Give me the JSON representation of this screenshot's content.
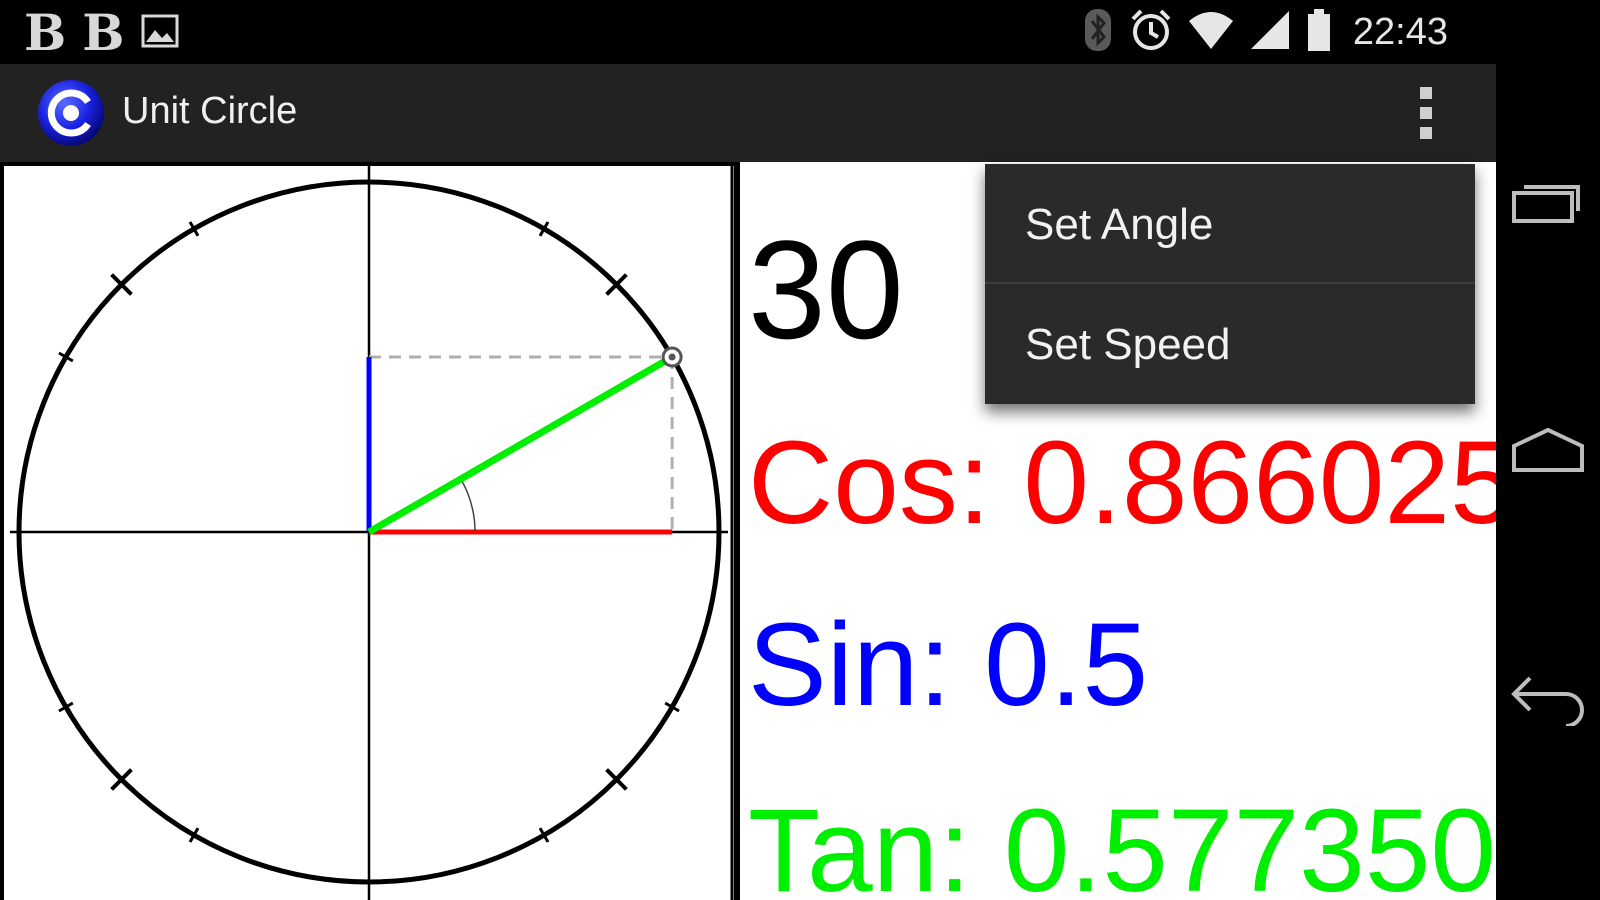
{
  "status_bar": {
    "left_icons": [
      {
        "name": "b-notification-icon",
        "glyph": "B"
      },
      {
        "name": "b-notification-icon",
        "glyph": "B"
      },
      {
        "name": "image-notification-icon"
      }
    ],
    "right_icons": [
      "bluetooth-icon",
      "alarm-clock-icon",
      "wifi-icon",
      "cell-signal-icon",
      "battery-icon"
    ],
    "time": "22:43"
  },
  "action_bar": {
    "title": "Unit Circle",
    "app_icon": "unit-circle-app-icon",
    "overflow_icon": "overflow-menu-icon"
  },
  "menu": {
    "items": [
      {
        "label": "Set Angle"
      },
      {
        "label": "Set Speed"
      }
    ]
  },
  "display": {
    "angle": "30",
    "cos": "Cos: 0.866025",
    "sin": "Sin: 0.5",
    "tan": "Tan: 0.577350"
  },
  "circle": {
    "angle_degrees": 30,
    "colors": {
      "cos": "#ff0000",
      "sin": "#0000ff",
      "radius": "#00ee00",
      "projection": "#b0b0b0",
      "circle": "#000000"
    }
  },
  "nav_bar": {
    "buttons": [
      "recent-apps-icon",
      "home-icon",
      "back-icon"
    ]
  },
  "colors": {
    "status_bar_bg": "#000000",
    "action_bar_bg": "#222222",
    "menu_bg": "#2a2a2a"
  }
}
